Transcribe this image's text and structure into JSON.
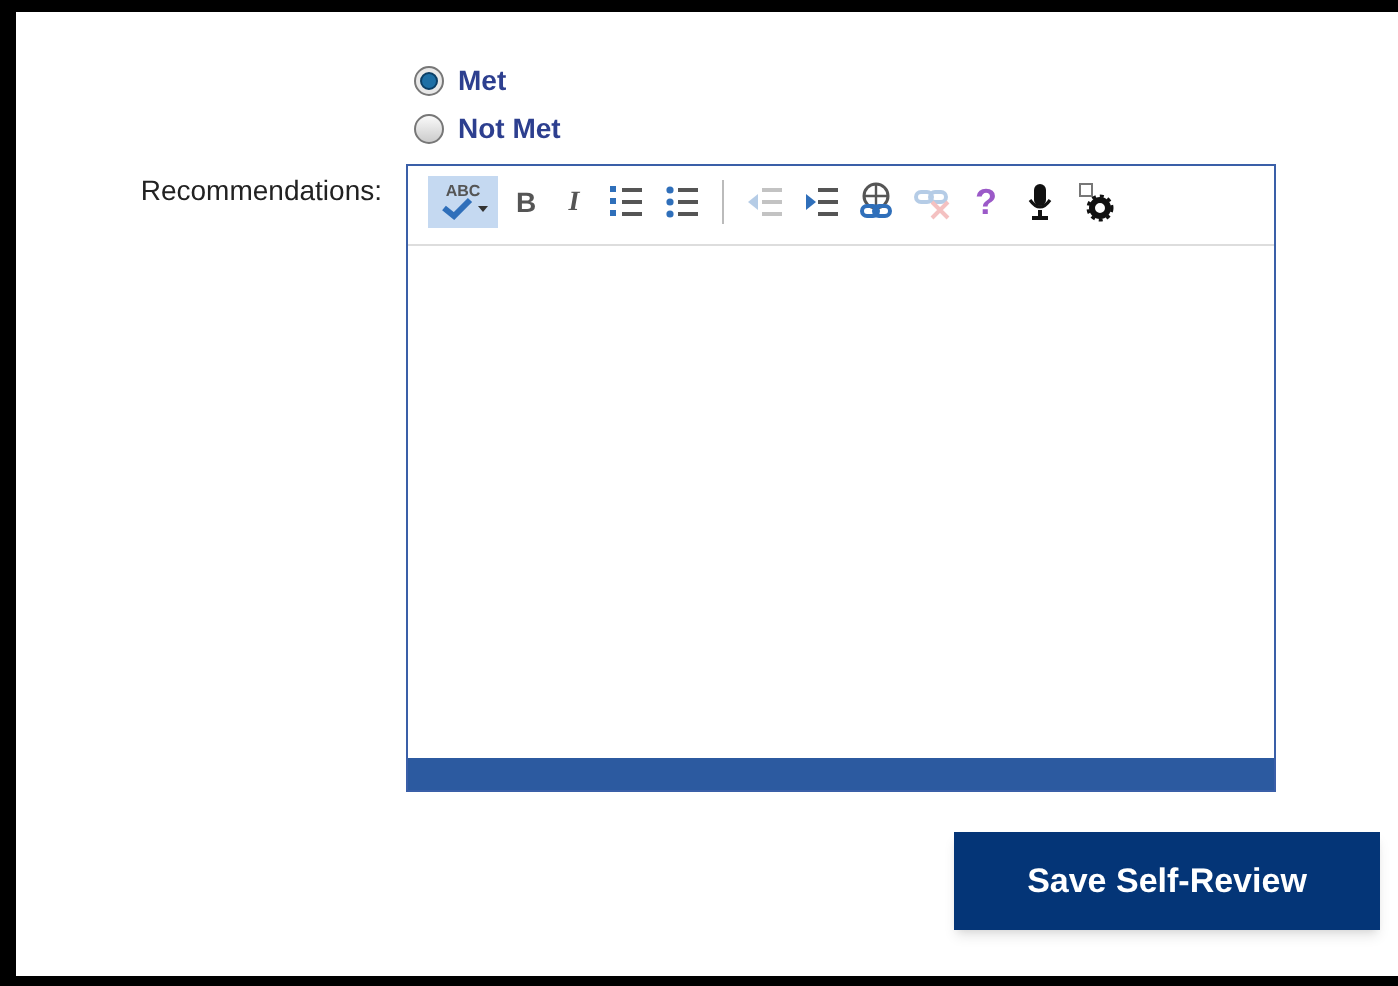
{
  "review_options": [
    {
      "label": "Met",
      "selected": true
    },
    {
      "label": "Not Met",
      "selected": false
    }
  ],
  "recommendations": {
    "label": "Recommendations:",
    "toolbar": [
      {
        "kind": "spellcheck",
        "label": "ABC",
        "active": true,
        "disabled": false
      },
      {
        "kind": "bold",
        "label": "B",
        "active": false,
        "disabled": false
      },
      {
        "kind": "italic",
        "label": "I",
        "active": false,
        "disabled": false
      },
      {
        "kind": "numbered-list",
        "active": false,
        "disabled": false
      },
      {
        "kind": "bullet-list",
        "active": false,
        "disabled": false
      },
      {
        "kind": "separator"
      },
      {
        "kind": "outdent",
        "active": false,
        "disabled": true
      },
      {
        "kind": "indent",
        "active": false,
        "disabled": false
      },
      {
        "kind": "link",
        "active": false,
        "disabled": false
      },
      {
        "kind": "unlink",
        "active": false,
        "disabled": true
      },
      {
        "kind": "help",
        "label": "?",
        "active": false,
        "disabled": false
      },
      {
        "kind": "microphone",
        "active": false,
        "disabled": false
      },
      {
        "kind": "settings",
        "active": false,
        "disabled": false
      }
    ]
  },
  "save_button": "Save Self-Review"
}
